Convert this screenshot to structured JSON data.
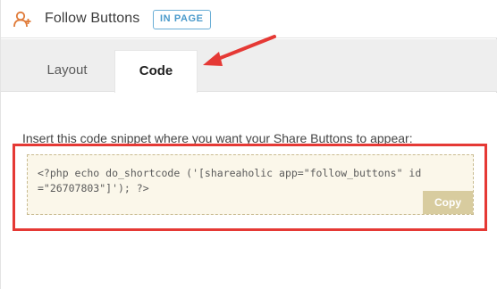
{
  "header": {
    "icon": "user-plus-icon",
    "title": "Follow Buttons",
    "badge": "IN PAGE",
    "icon_color": "#e07b39",
    "badge_color": "#4a9acb"
  },
  "tabs": [
    {
      "label": "Layout",
      "active": false
    },
    {
      "label": "Code",
      "active": true
    }
  ],
  "content": {
    "instructions": "Insert this code snippet where you want your Share Buttons to appear:",
    "snippet": "<?php echo do_shortcode ('[shareaholic app=\"follow_buttons\" id=\"26707803\"]'); ?>",
    "copy_label": "Copy"
  },
  "annotation": {
    "arrow_color": "#e53935",
    "highlight_color": "#e53935"
  }
}
